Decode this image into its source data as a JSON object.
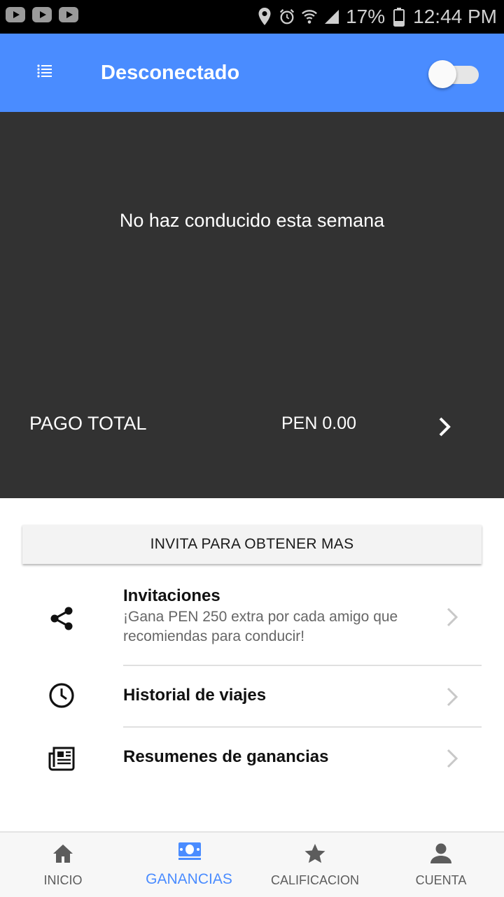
{
  "status_bar": {
    "battery_percent": "17%",
    "time": "12:44 PM",
    "icons": [
      "youtube-icon",
      "youtube-icon",
      "youtube-icon",
      "location-icon",
      "alarm-icon",
      "wifi-icon",
      "signal-icon",
      "battery-icon"
    ]
  },
  "app_bar": {
    "title": "Desconectado",
    "menu_icon": "list-menu-icon",
    "toggle_on": false,
    "accent_color": "#4a8cff"
  },
  "earnings": {
    "empty_message": "No haz conducido esta semana",
    "total_label": "PAGO TOTAL",
    "total_amount": "PEN 0.00"
  },
  "invite_button": {
    "label": "INVITA PARA OBTENER MAS"
  },
  "list": [
    {
      "icon": "share-icon",
      "title": "Invitaciones",
      "subtitle": "¡Gana PEN 250 extra por cada amigo que recomiendas para conducir!"
    },
    {
      "icon": "clock-icon",
      "title": "Historial de viajes"
    },
    {
      "icon": "newspaper-icon",
      "title": "Resumenes de ganancias"
    }
  ],
  "bottom_nav": [
    {
      "icon": "home-icon",
      "label": "INICIO",
      "active": false
    },
    {
      "icon": "money-icon",
      "label": "GANANCIAS",
      "active": true
    },
    {
      "icon": "star-icon",
      "label": "CALIFICACION",
      "active": false
    },
    {
      "icon": "person-icon",
      "label": "CUENTA",
      "active": false
    }
  ]
}
